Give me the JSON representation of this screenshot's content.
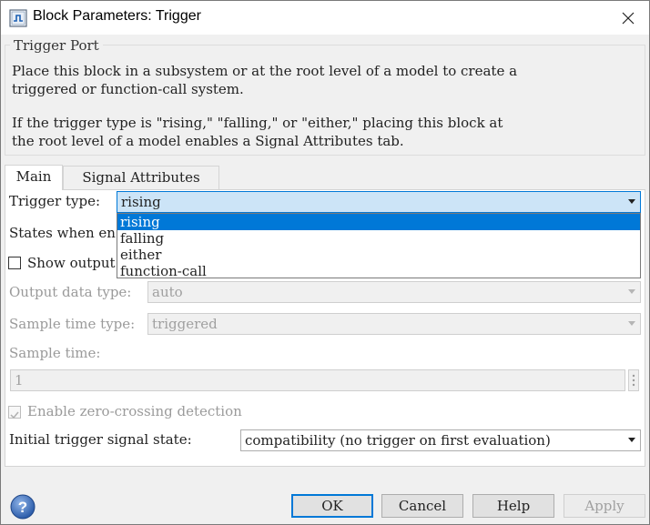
{
  "window": {
    "title": "Block Parameters: Trigger",
    "icon": "simulink-block-icon",
    "close_icon": "close-icon"
  },
  "group": {
    "label": "Trigger Port",
    "description": [
      "Place this block in a subsystem or at the root level of a model to create a",
      "triggered or function-call system.",
      "If the trigger type is \"rising,\" \"falling,\" or \"either,\" placing this block at",
      "the root level of a model enables a Signal Attributes tab."
    ]
  },
  "tabs": [
    {
      "label": "Main",
      "active": true
    },
    {
      "label": "Signal Attributes",
      "active": false
    }
  ],
  "main": {
    "trigger_type_label": "Trigger type:",
    "trigger_type_value": "rising",
    "trigger_type_options": [
      "rising",
      "falling",
      "either",
      "function-call"
    ],
    "states_label": "States when en",
    "show_output_label": "Show output",
    "show_output_checked": false,
    "output_data_type_label": "Output data type:",
    "output_data_type_value": "auto",
    "sample_time_type_label": "Sample time type:",
    "sample_time_type_value": "triggered",
    "sample_time_label": "Sample time:",
    "sample_time_value": "1",
    "zero_crossing_label": "Enable zero-crossing detection",
    "zero_crossing_checked": true,
    "initial_state_label": "Initial trigger signal state:",
    "initial_state_value": "compatibility (no trigger on first evaluation)"
  },
  "buttons": {
    "ok": "OK",
    "cancel": "Cancel",
    "help": "Help",
    "apply": "Apply"
  },
  "colors": {
    "accent": "#0078d7",
    "selection_bg": "#cce4f7"
  }
}
